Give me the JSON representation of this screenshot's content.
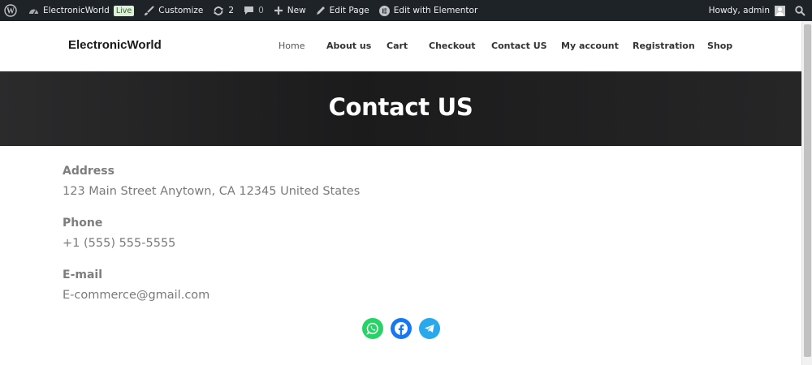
{
  "adminbar": {
    "site_name": "ElectronicWorld",
    "live_badge": "Live",
    "customize": "Customize",
    "updates_count": "2",
    "comments_count": "0",
    "new": "New",
    "edit_page": "Edit Page",
    "edit_elementor": "Edit with Elementor",
    "howdy": "Howdy, admin"
  },
  "header": {
    "site_title": "ElectronicWorld",
    "nav": [
      "Home",
      "About us",
      "Cart",
      "Checkout",
      "Contact US",
      "My account",
      "Registration",
      "Shop"
    ]
  },
  "hero": {
    "title": "Contact US"
  },
  "contact": {
    "address_label": "Address",
    "address_value": "123 Main Street Anytown, CA 12345 United States",
    "phone_label": "Phone",
    "phone_value": "+1 (555) 555-5555",
    "email_label": "E-mail",
    "email_value": "E-commerce@gmail.com"
  },
  "social": [
    {
      "icon": "whatsapp-icon",
      "color": "#25d366"
    },
    {
      "icon": "facebook-icon",
      "color": "#1877f2"
    },
    {
      "icon": "telegram-icon",
      "color": "#29a9eb"
    }
  ],
  "colors": {
    "adminbar_bg": "#1d2327",
    "hero_bg": "#222223",
    "text_gray": "#7a7a7a"
  }
}
